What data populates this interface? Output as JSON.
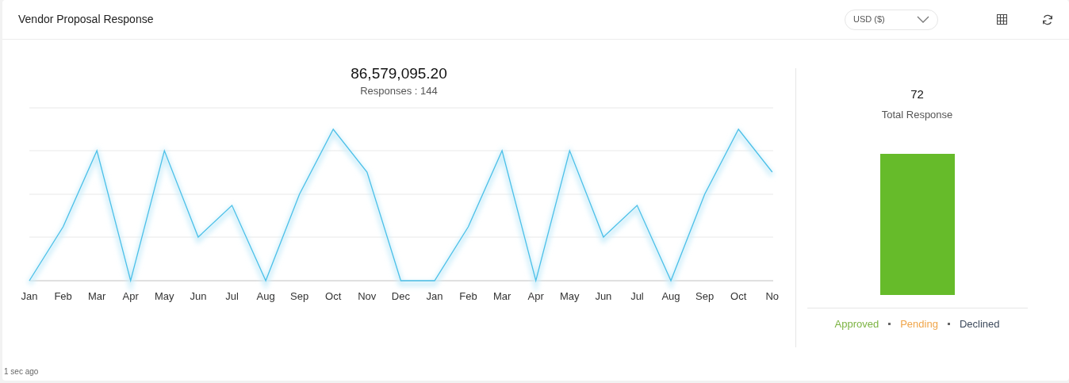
{
  "header": {
    "title": "Vendor Proposal Response",
    "currency": {
      "value": "USD ($)"
    }
  },
  "line_panel": {
    "total": "86,579,095.20",
    "subtitle": "Responses : 144",
    "x_labels": [
      "Jan",
      "Feb",
      "Mar",
      "Apr",
      "May",
      "Jun",
      "Jul",
      "Aug",
      "Sep",
      "Oct",
      "Nov",
      "Dec",
      "Jan",
      "Feb",
      "Mar",
      "Apr",
      "May",
      "Jun",
      "Jul",
      "Aug",
      "Sep",
      "Oct",
      "No"
    ]
  },
  "bar_panel": {
    "count": "72",
    "label": "Total Response",
    "legend": [
      {
        "label": "Approved",
        "color": "#7cb342"
      },
      {
        "label": "Pending",
        "color": "#f0a54a"
      },
      {
        "label": "Declined",
        "color": "#3d4a5c"
      }
    ]
  },
  "footer": {
    "updated": "1 sec ago"
  }
}
